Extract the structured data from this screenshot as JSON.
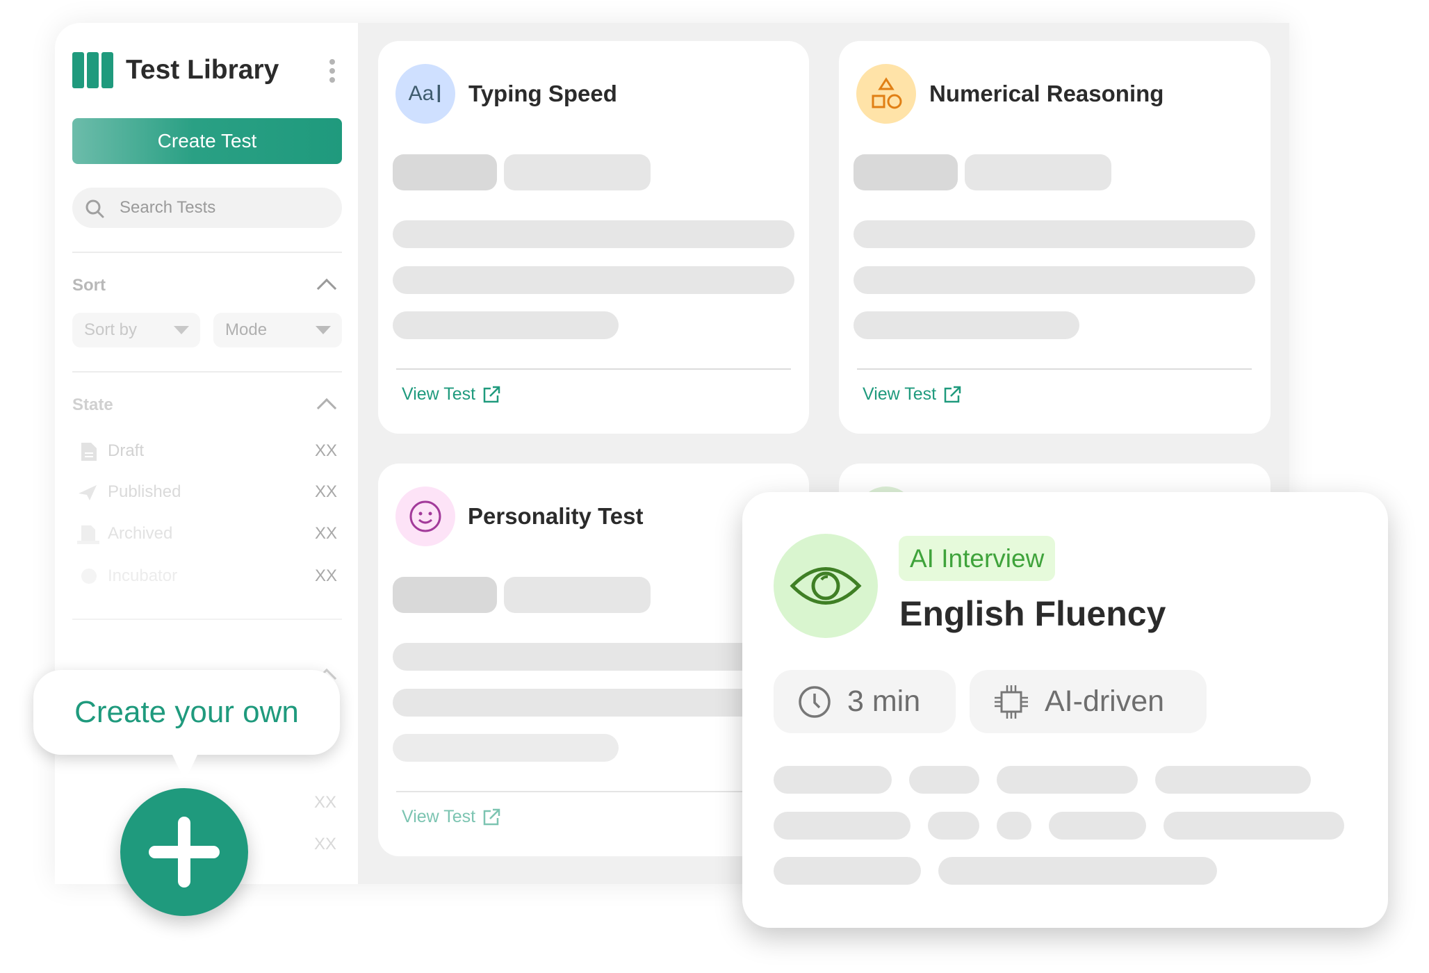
{
  "sidebar": {
    "title": "Test Library",
    "create_button": "Create Test",
    "search_placeholder": "Search Tests",
    "sort": {
      "label": "Sort",
      "sort_by": "Sort by",
      "mode": "Mode"
    },
    "state": {
      "label": "State",
      "items": [
        {
          "label": "Draft",
          "count": "XX",
          "icon": "document-icon"
        },
        {
          "label": "Published",
          "count": "XX",
          "icon": "paper-plane-icon"
        },
        {
          "label": "Archived",
          "count": "XX",
          "icon": "archive-icon"
        },
        {
          "label": "Incubator",
          "count": "XX",
          "icon": "incubator-icon"
        }
      ]
    },
    "extra_counts": [
      "XX",
      "XX"
    ]
  },
  "cards": [
    {
      "title": "Typing Speed",
      "icon": "text-cursor-icon",
      "icon_bg": "#cfe0ff",
      "link": "View Test"
    },
    {
      "title": "Numerical Reasoning",
      "icon": "shapes-icon",
      "icon_bg": "#ffe3a8",
      "link": "View Test"
    },
    {
      "title": "Personality Test",
      "icon": "smiley-icon",
      "icon_bg": "#fde3f7",
      "link": "View Test"
    }
  ],
  "featured": {
    "badge": "AI Interview",
    "title": "English Fluency",
    "duration": "3 min",
    "mode": "AI-driven",
    "icon": "eye-icon"
  },
  "tooltip": {
    "text": "Create your own"
  },
  "colors": {
    "accent": "#1f9a7d",
    "badge_bg": "#e6fadb",
    "badge_text": "#3fa33b"
  }
}
